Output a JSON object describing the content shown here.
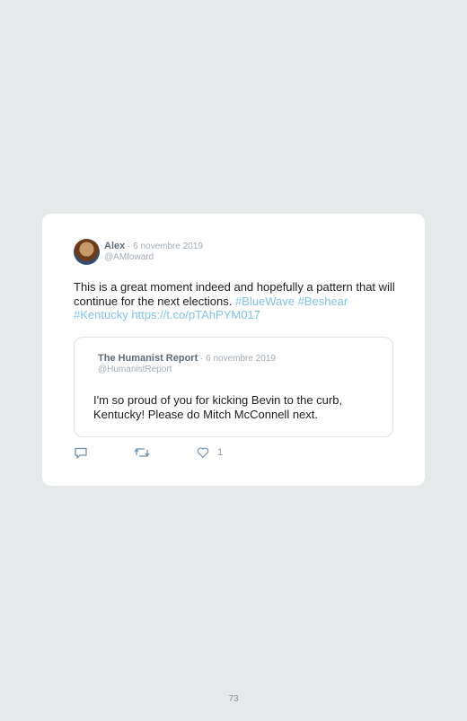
{
  "tweet": {
    "author_name": "Alex",
    "separator": " · ",
    "date": "6 novembre 2019",
    "handle": "@AMfoward",
    "text_plain": "This is a great moment indeed and hopefully a pattern that will continue for the next elections. ",
    "hashtag_1": "#BlueWave",
    "hashtag_2": "#Beshear",
    "hashtag_3": "#Kentucky",
    "link": "https://t.co/pTAhPYM017"
  },
  "quoted_tweet": {
    "author_name": "The Humanist Report",
    "separator": " · ",
    "date": "6 novembre 2019",
    "handle": "@HumanistReport",
    "text": "I'm so proud of you for kicking Bevin to the curb, Kentucky! Please do Mitch McConnell next."
  },
  "actions": {
    "reply_icon": "reply-icon",
    "retweet_icon": "retweet-icon",
    "like_icon": "heart-icon",
    "like_count": "1"
  },
  "page_number": "73",
  "colors": {
    "background": "#e6e9ea",
    "link": "#7fc4e4",
    "name": "#5d6b78",
    "muted": "#a3acb4"
  }
}
